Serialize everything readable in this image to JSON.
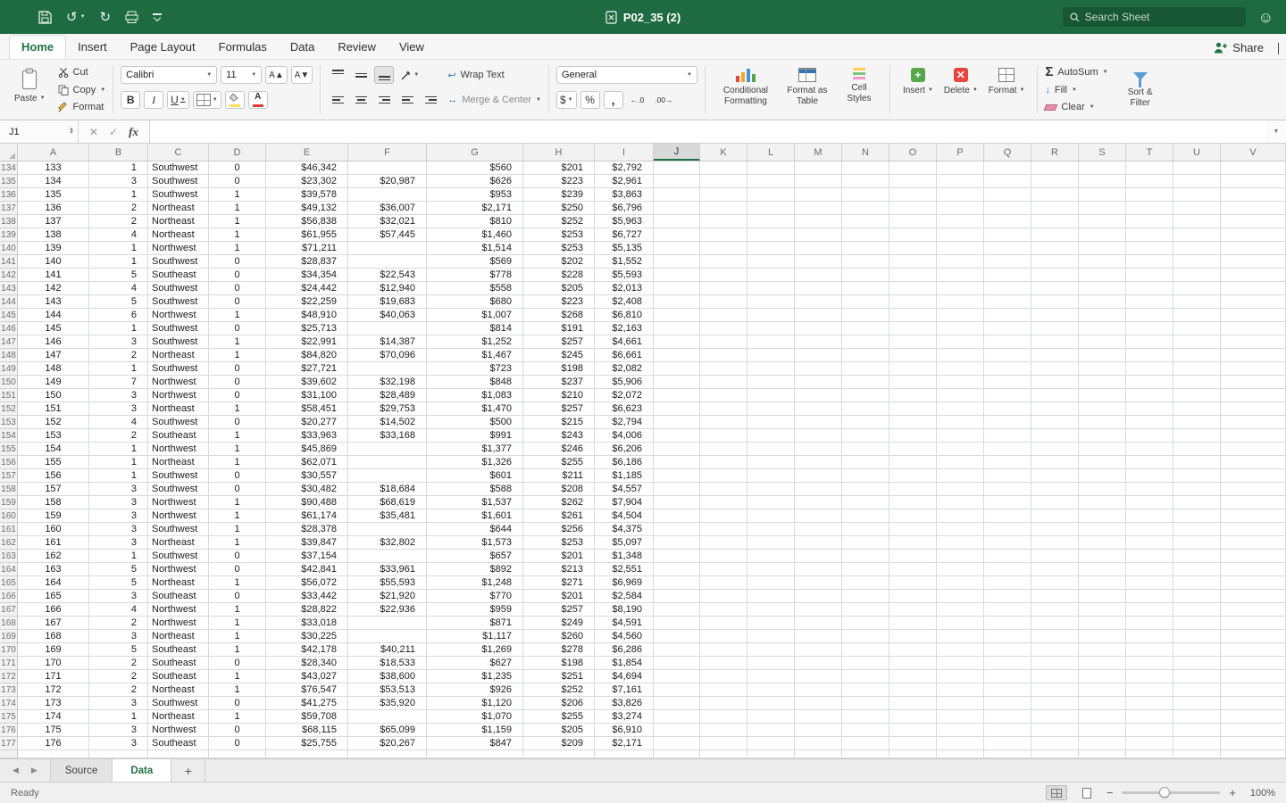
{
  "title_bar": {
    "title": "P02_35 (2)",
    "search_placeholder": "Search Sheet"
  },
  "ribbon": {
    "tabs": [
      "Home",
      "Insert",
      "Page Layout",
      "Formulas",
      "Data",
      "Review",
      "View"
    ],
    "active_tab": "Home",
    "share_label": "Share",
    "paste_label": "Paste",
    "cut_label": "Cut",
    "copy_label": "Copy",
    "format_painter_label": "Format",
    "font_name": "Calibri",
    "font_size": "11",
    "wrap_text_label": "Wrap Text",
    "merge_center_label": "Merge & Center",
    "number_format": "General",
    "conditional_formatting_label": "Conditional Formatting",
    "format_as_table_label": "Format as Table",
    "cell_styles_label": "Cell Styles",
    "insert_label": "Insert",
    "delete_label": "Delete",
    "format_label": "Format",
    "autosum_label": "AutoSum",
    "fill_label": "Fill",
    "clear_label": "Clear",
    "sort_filter_label": "Sort & Filter"
  },
  "formula_bar": {
    "name_box": "J1",
    "formula": ""
  },
  "grid": {
    "columns": [
      "A",
      "B",
      "C",
      "D",
      "E",
      "F",
      "G",
      "H",
      "I",
      "J",
      "K",
      "L",
      "M",
      "N",
      "O",
      "P",
      "Q",
      "R",
      "S",
      "T",
      "U",
      "V"
    ],
    "selected_column": "J",
    "rows": [
      [
        "134",
        "133",
        "1",
        "Southwest",
        "0",
        "$46,342",
        "",
        "$560",
        "$201",
        "$2,792"
      ],
      [
        "135",
        "134",
        "3",
        "Southwest",
        "0",
        "$23,302",
        "$20,987",
        "$626",
        "$223",
        "$2,961"
      ],
      [
        "136",
        "135",
        "1",
        "Southwest",
        "1",
        "$39,578",
        "",
        "$953",
        "$239",
        "$3,863"
      ],
      [
        "137",
        "136",
        "2",
        "Northeast",
        "1",
        "$49,132",
        "$36,007",
        "$2,171",
        "$250",
        "$6,796"
      ],
      [
        "138",
        "137",
        "2",
        "Northeast",
        "1",
        "$56,838",
        "$32,021",
        "$810",
        "$252",
        "$5,963"
      ],
      [
        "139",
        "138",
        "4",
        "Northeast",
        "1",
        "$61,955",
        "$57,445",
        "$1,460",
        "$253",
        "$6,727"
      ],
      [
        "140",
        "139",
        "1",
        "Northwest",
        "1",
        "$71,211",
        "",
        "$1,514",
        "$253",
        "$5,135"
      ],
      [
        "141",
        "140",
        "1",
        "Southwest",
        "0",
        "$28,837",
        "",
        "$569",
        "$202",
        "$1,552"
      ],
      [
        "142",
        "141",
        "5",
        "Southeast",
        "0",
        "$34,354",
        "$22,543",
        "$778",
        "$228",
        "$5,593"
      ],
      [
        "143",
        "142",
        "4",
        "Southwest",
        "0",
        "$24,442",
        "$12,940",
        "$558",
        "$205",
        "$2,013"
      ],
      [
        "144",
        "143",
        "5",
        "Southwest",
        "0",
        "$22,259",
        "$19,683",
        "$680",
        "$223",
        "$2,408"
      ],
      [
        "145",
        "144",
        "6",
        "Northwest",
        "1",
        "$48,910",
        "$40,063",
        "$1,007",
        "$268",
        "$6,810"
      ],
      [
        "146",
        "145",
        "1",
        "Southwest",
        "0",
        "$25,713",
        "",
        "$814",
        "$191",
        "$2,163"
      ],
      [
        "147",
        "146",
        "3",
        "Southwest",
        "1",
        "$22,991",
        "$14,387",
        "$1,252",
        "$257",
        "$4,661"
      ],
      [
        "148",
        "147",
        "2",
        "Northeast",
        "1",
        "$84,820",
        "$70,096",
        "$1,467",
        "$245",
        "$6,661"
      ],
      [
        "149",
        "148",
        "1",
        "Southwest",
        "0",
        "$27,721",
        "",
        "$723",
        "$198",
        "$2,082"
      ],
      [
        "150",
        "149",
        "7",
        "Northwest",
        "0",
        "$39,602",
        "$32,198",
        "$848",
        "$237",
        "$5,906"
      ],
      [
        "151",
        "150",
        "3",
        "Northwest",
        "0",
        "$31,100",
        "$28,489",
        "$1,083",
        "$210",
        "$2,072"
      ],
      [
        "152",
        "151",
        "3",
        "Northeast",
        "1",
        "$58,451",
        "$29,753",
        "$1,470",
        "$257",
        "$6,623"
      ],
      [
        "153",
        "152",
        "4",
        "Southwest",
        "0",
        "$20,277",
        "$14,502",
        "$500",
        "$215",
        "$2,794"
      ],
      [
        "154",
        "153",
        "2",
        "Southeast",
        "1",
        "$33,963",
        "$33,168",
        "$991",
        "$243",
        "$4,006"
      ],
      [
        "155",
        "154",
        "1",
        "Northwest",
        "1",
        "$45,869",
        "",
        "$1,377",
        "$246",
        "$6,206"
      ],
      [
        "156",
        "155",
        "1",
        "Northeast",
        "1",
        "$62,071",
        "",
        "$1,326",
        "$255",
        "$6,186"
      ],
      [
        "157",
        "156",
        "1",
        "Southwest",
        "0",
        "$30,557",
        "",
        "$601",
        "$211",
        "$1,185"
      ],
      [
        "158",
        "157",
        "3",
        "Southwest",
        "0",
        "$30,482",
        "$18,684",
        "$588",
        "$208",
        "$4,557"
      ],
      [
        "159",
        "158",
        "3",
        "Northwest",
        "1",
        "$90,488",
        "$68,619",
        "$1,537",
        "$262",
        "$7,904"
      ],
      [
        "160",
        "159",
        "3",
        "Northwest",
        "1",
        "$61,174",
        "$35,481",
        "$1,601",
        "$261",
        "$4,504"
      ],
      [
        "161",
        "160",
        "3",
        "Southwest",
        "1",
        "$28,378",
        "",
        "$644",
        "$256",
        "$4,375"
      ],
      [
        "162",
        "161",
        "3",
        "Northeast",
        "1",
        "$39,847",
        "$32,802",
        "$1,573",
        "$253",
        "$5,097"
      ],
      [
        "163",
        "162",
        "1",
        "Southwest",
        "0",
        "$37,154",
        "",
        "$657",
        "$201",
        "$1,348"
      ],
      [
        "164",
        "163",
        "5",
        "Northwest",
        "0",
        "$42,841",
        "$33,961",
        "$892",
        "$213",
        "$2,551"
      ],
      [
        "165",
        "164",
        "5",
        "Northeast",
        "1",
        "$56,072",
        "$55,593",
        "$1,248",
        "$271",
        "$6,969"
      ],
      [
        "166",
        "165",
        "3",
        "Southeast",
        "0",
        "$33,442",
        "$21,920",
        "$770",
        "$201",
        "$2,584"
      ],
      [
        "167",
        "166",
        "4",
        "Northwest",
        "1",
        "$28,822",
        "$22,936",
        "$959",
        "$257",
        "$8,190"
      ],
      [
        "168",
        "167",
        "2",
        "Northwest",
        "1",
        "$33,018",
        "",
        "$871",
        "$249",
        "$4,591"
      ],
      [
        "169",
        "168",
        "3",
        "Northeast",
        "1",
        "$30,225",
        "",
        "$1,117",
        "$260",
        "$4,560"
      ],
      [
        "170",
        "169",
        "5",
        "Southeast",
        "1",
        "$42,178",
        "$40,211",
        "$1,269",
        "$278",
        "$6,286"
      ],
      [
        "171",
        "170",
        "2",
        "Southeast",
        "0",
        "$28,340",
        "$18,533",
        "$627",
        "$198",
        "$1,854"
      ],
      [
        "172",
        "171",
        "2",
        "Southeast",
        "1",
        "$43,027",
        "$38,600",
        "$1,235",
        "$251",
        "$4,694"
      ],
      [
        "173",
        "172",
        "2",
        "Northeast",
        "1",
        "$76,547",
        "$53,513",
        "$926",
        "$252",
        "$7,161"
      ],
      [
        "174",
        "173",
        "3",
        "Southwest",
        "0",
        "$41,275",
        "$35,920",
        "$1,120",
        "$206",
        "$3,826"
      ],
      [
        "175",
        "174",
        "1",
        "Northeast",
        "1",
        "$59,708",
        "",
        "$1,070",
        "$255",
        "$3,274"
      ],
      [
        "176",
        "175",
        "3",
        "Northwest",
        "0",
        "$68,115",
        "$65,099",
        "$1,159",
        "$205",
        "$6,910"
      ],
      [
        "177",
        "176",
        "3",
        "Southeast",
        "0",
        "$25,755",
        "$20,267",
        "$847",
        "$209",
        "$2,171"
      ]
    ]
  },
  "sheet_tabs": {
    "tabs": [
      "Source",
      "Data"
    ],
    "active_tab": "Data",
    "add_label": "+"
  },
  "status_bar": {
    "status": "Ready",
    "zoom": "100%"
  },
  "icons": {
    "dropdown": "▼",
    "spinner_up": "▲",
    "spinner_down": "▼",
    "cancel": "✕",
    "enter": "✓",
    "function": "fx",
    "undo": "↺",
    "redo": "↻",
    "smiley": "☺",
    "prev_sheet": "◀",
    "next_sheet": "▶",
    "bold": "B",
    "italic": "I",
    "underline": "U",
    "font_increase": "A▲",
    "font_decrease": "A▼",
    "font_color": "A",
    "dollar": "$",
    "percent": "%",
    "comma": ",",
    "increase_decimal": "←.0",
    "decrease_decimal": ".00→",
    "autosum": "Σ",
    "fill_arrow": "↓",
    "wrap_arrow": "↩",
    "merge_arrows": "↔",
    "minus": "−",
    "plus": "+"
  }
}
